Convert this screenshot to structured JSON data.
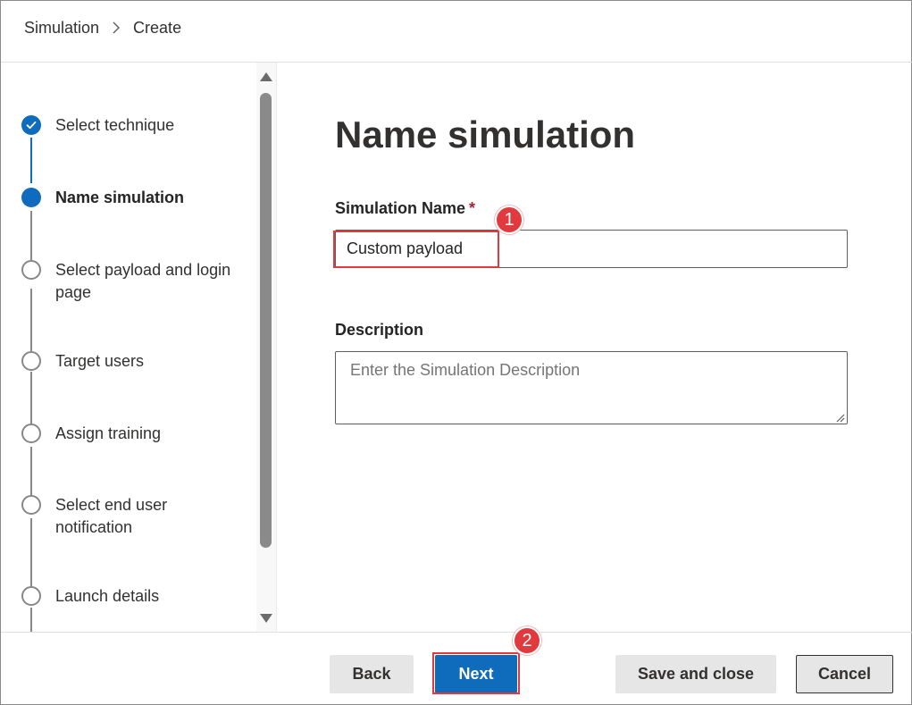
{
  "breadcrumb": {
    "items": [
      "Simulation",
      "Create"
    ]
  },
  "steps": [
    {
      "label": "Select technique",
      "state": "done"
    },
    {
      "label": "Name simulation",
      "state": "active"
    },
    {
      "label": "Select payload and login page",
      "state": "pending"
    },
    {
      "label": "Target users",
      "state": "pending"
    },
    {
      "label": "Assign training",
      "state": "pending"
    },
    {
      "label": "Select end user notification",
      "state": "pending"
    },
    {
      "label": "Launch details",
      "state": "pending"
    }
  ],
  "main": {
    "title": "Name simulation",
    "name_field": {
      "label": "Simulation Name",
      "required_marker": "*",
      "value": "Custom payload"
    },
    "description_field": {
      "label": "Description",
      "placeholder": "Enter the Simulation Description"
    }
  },
  "annotations": {
    "badge_1": "1",
    "badge_2": "2"
  },
  "footer": {
    "back_label": "Back",
    "next_label": "Next",
    "save_label": "Save and close",
    "cancel_label": "Cancel"
  },
  "colors": {
    "accent": "#0f6cbd",
    "highlight": "#e0393e",
    "required": "#a4262c"
  }
}
